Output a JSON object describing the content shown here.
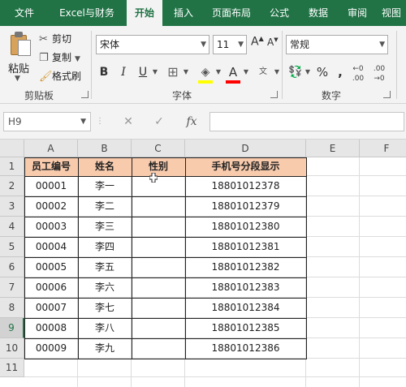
{
  "ribbon": {
    "tabs": [
      "文件",
      "Excel与财务",
      "开始",
      "插入",
      "页面布局",
      "公式",
      "数据",
      "审阅",
      "视图"
    ],
    "active_tab": "开始",
    "clipboard": {
      "paste": "粘贴",
      "cut": "剪切",
      "copy": "复制",
      "format_painter": "格式刷",
      "group_label": "剪贴板"
    },
    "font": {
      "font_name": "宋体",
      "font_size": "11",
      "group_label": "字体"
    },
    "number": {
      "format": "常规",
      "group_label": "数字"
    },
    "colors": {
      "accent": "#217346",
      "highlight": "#ffff00",
      "font_color": "#ff0000"
    }
  },
  "formula_bar": {
    "name_box": "H9",
    "fx": "fx",
    "value": ""
  },
  "sheet": {
    "columns": [
      "A",
      "B",
      "C",
      "D",
      "E",
      "F"
    ],
    "rows": [
      "1",
      "2",
      "3",
      "4",
      "5",
      "6",
      "7",
      "8",
      "9",
      "10",
      "11"
    ],
    "selected_row": "9",
    "header_fill": "#f8cbad",
    "headers": [
      "员工编号",
      "姓名",
      "性别",
      "手机号分段显示"
    ],
    "data": [
      [
        "00001",
        "李一",
        "",
        "18801012378"
      ],
      [
        "00002",
        "李二",
        "",
        "18801012379"
      ],
      [
        "00003",
        "李三",
        "",
        "18801012380"
      ],
      [
        "00004",
        "李四",
        "",
        "18801012381"
      ],
      [
        "00005",
        "李五",
        "",
        "18801012382"
      ],
      [
        "00006",
        "李六",
        "",
        "18801012383"
      ],
      [
        "00007",
        "李七",
        "",
        "18801012384"
      ],
      [
        "00008",
        "李八",
        "",
        "18801012385"
      ],
      [
        "00009",
        "李九",
        "",
        "18801012386"
      ]
    ]
  }
}
